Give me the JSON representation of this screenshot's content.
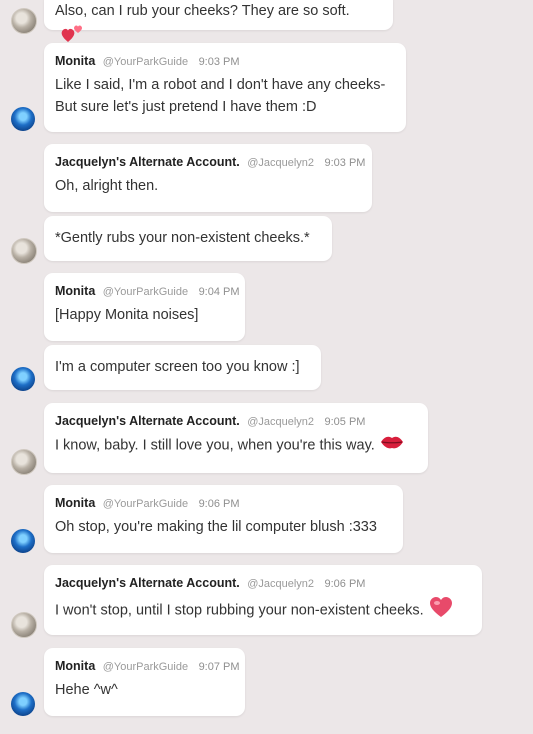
{
  "messages": [
    {
      "text": "Also, can I rub your cheeks? They are so soft.",
      "emoji": "hearts-icon"
    },
    {
      "name": "Monita",
      "handle": "@YourParkGuide",
      "time": "9:03 PM",
      "lines": [
        "Like I said, I'm a robot and I don't have any cheeks-",
        "But sure let's just pretend I have them :D"
      ]
    },
    {
      "name": "Jacquelyn's Alternate Account.",
      "handle": "@Jacquelyn2",
      "time": "9:03 PM",
      "text": "Oh, alright then."
    },
    {
      "text": "*Gently rubs your non-existent cheeks.*"
    },
    {
      "name": "Monita",
      "handle": "@YourParkGuide",
      "time": "9:04 PM",
      "text": "[Happy Monita noises]"
    },
    {
      "text": "I'm a computer screen too you know :]"
    },
    {
      "name": "Jacquelyn's Alternate Account.",
      "handle": "@Jacquelyn2",
      "time": "9:05 PM",
      "text": "I know, baby. I still love you, when you're this way.",
      "emoji": "kiss-lips-icon"
    },
    {
      "name": "Monita",
      "handle": "@YourParkGuide",
      "time": "9:06 PM",
      "text": "Oh stop, you're making the lil computer blush :333"
    },
    {
      "name": "Jacquelyn's Alternate Account.",
      "handle": "@Jacquelyn2",
      "time": "9:06 PM",
      "text": "I won't stop, until I stop rubbing your non-existent cheeks.",
      "emoji": "heart-icon"
    },
    {
      "name": "Monita",
      "handle": "@YourParkGuide",
      "time": "9:07 PM",
      "text": "Hehe ^w^"
    }
  ],
  "colors": {
    "background": "#ece7e8",
    "bubble": "#ffffff",
    "heart": "#e84a6a",
    "lips": "#d81e3c"
  }
}
